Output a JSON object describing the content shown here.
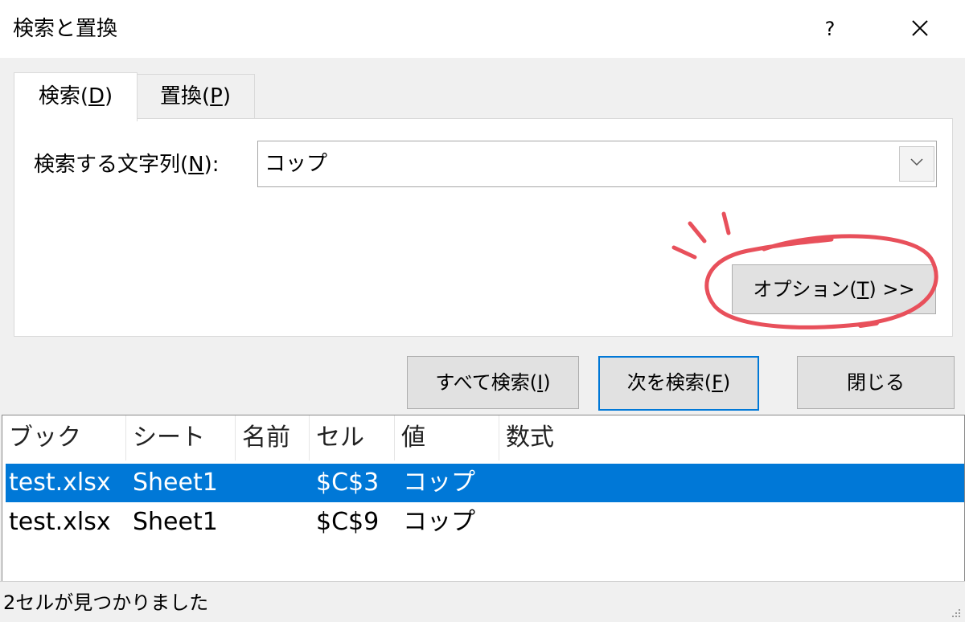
{
  "window": {
    "title": "検索と置換",
    "help_label": "?",
    "close_icon": "close-icon"
  },
  "tabs": [
    {
      "label": "検索(",
      "mnemonic": "D",
      "suffix": ")",
      "active": true
    },
    {
      "label": "置換(",
      "mnemonic": "P",
      "suffix": ")",
      "active": false
    }
  ],
  "find": {
    "label_prefix": "検索する文字列(",
    "label_mnemonic": "N",
    "label_suffix": "):",
    "value": "コップ",
    "dropdown_icon": "chevron-down-icon"
  },
  "options_button": {
    "label_prefix": "オプション(",
    "mnemonic": "T",
    "label_suffix": ") >>"
  },
  "annotation": {
    "color": "#e8505b"
  },
  "buttons": {
    "find_all_prefix": "すべて検索(",
    "find_all_mnemonic": "I",
    "find_all_suffix": ")",
    "find_next_prefix": "次を検索(",
    "find_next_mnemonic": "F",
    "find_next_suffix": ")",
    "close": "閉じる"
  },
  "results": {
    "columns": [
      "ブック",
      "シート",
      "名前",
      "セル",
      "値",
      "数式"
    ],
    "rows": [
      {
        "book": "test.xlsx",
        "sheet": "Sheet1",
        "name": "",
        "cell": "$C$3",
        "value": "コップ",
        "formula": "",
        "selected": true
      },
      {
        "book": "test.xlsx",
        "sheet": "Sheet1",
        "name": "",
        "cell": "$C$9",
        "value": "コップ",
        "formula": "",
        "selected": false
      }
    ]
  },
  "status": {
    "text": "2セルが見つかりました"
  },
  "colors": {
    "selection": "#0078d7",
    "focus_border": "#0078d7"
  }
}
